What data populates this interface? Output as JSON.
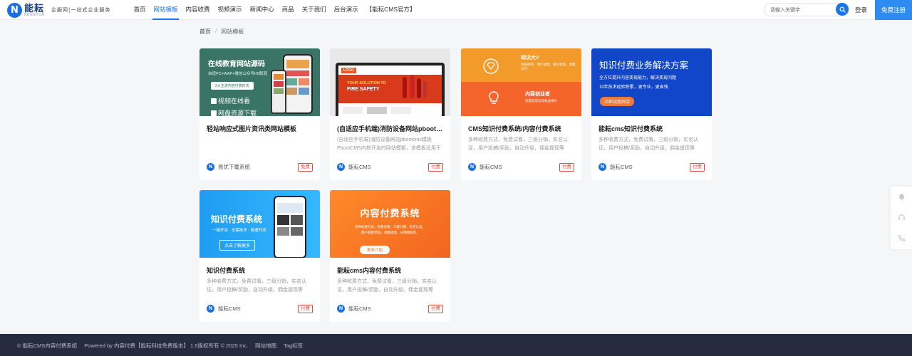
{
  "header": {
    "logo_mark": "N",
    "logo_name": "能耘",
    "logo_sub": "NENGYUN",
    "slogan": "企服网|一站式企业服务",
    "nav": [
      "首页",
      "网站模板",
      "内容收费",
      "视频演示",
      "新闻中心",
      "商品",
      "关于我们",
      "后台演示",
      "【能耘CMS官方】"
    ],
    "active_nav": 1,
    "search_placeholder": "请输入关键字",
    "login": "登录",
    "register": "免费注册"
  },
  "breadcrumb": {
    "home": "首页",
    "separator": "/",
    "current": "网站模板"
  },
  "cards": [
    {
      "title": "轻站响应式图片资讯类网站模板",
      "desc": "",
      "author": "易优下载系统",
      "badge": "免费",
      "image": {
        "headline": "在线教育网站源码",
        "sub": "自适PC+WAP+微信公众号H5联调",
        "tag": "2大主流内容付费形式",
        "line1": "视频在线看",
        "line2": "网盘资源下载"
      }
    },
    {
      "title": "(自适应手机端)消防设备网站pbootcms模板",
      "desc": "(自适应手机端)消防设备网站pbootcms模板 PbootCMS内核开发的网站模板，该模板适用于消防设备等企业",
      "author": "能耘CMS",
      "badge": "付费",
      "image": {
        "logo": "LOGO",
        "line1": "YOUR SOLUTION TO",
        "line2": "FIRE SAFETY"
      }
    },
    {
      "title": "CMS知识付费系统/内容付费系统",
      "desc": "多种收费方式，免费试看，三级分销，实名认证，用户投稿/奖励，自动升级，佣金提现等",
      "author": "能耘CMS",
      "badge": "付费",
      "image": {
        "top_title": "知识大V",
        "top_sub": "内容创作、用户运营、知识变现、流量合作",
        "bottom_title": "内容创业者",
        "bottom_sub": "流量变现实现收益增长"
      }
    },
    {
      "title": "能耘cms知识付费系统",
      "desc": "多种收费方式，免费试看，三级分销，实名认证，用户投稿/奖励，自动升级，佣金提现等",
      "author": "能耘CMS",
      "badge": "付费",
      "image": {
        "headline": "知识付费业务解决方案",
        "sub1": "全方位提升内容变现能力，解决变现问题",
        "sub2": "10年技术经验积累，更专业，更省钱",
        "button": "立即试用开店"
      }
    },
    {
      "title": "知识付费系统",
      "desc": "多种收费方式，免费试看，三级分销，实名认证，用户投稿/奖励，自动升级，佣金提现等",
      "author": "能耘CMS",
      "badge": "付费",
      "image": {
        "headline": "知识付费系统",
        "sub": "一键开店 · 无需技术 · 极速开店",
        "button": "点击了解更多"
      }
    },
    {
      "title": "能耘cms内容付费系统",
      "desc": "多种收费方式，免费试看，三级分销，实名认证，用户投稿/奖励，自动升级，佣金提现等",
      "author": "能耘CMS",
      "badge": "付费",
      "image": {
        "headline": "内容付费系统",
        "sub1": "多种收费方式，免费试看，三级分销，实名认证，",
        "sub2": "用户投稿/奖励，佣金提现，分销佣金等。",
        "button": "更多介绍"
      }
    }
  ],
  "footer": {
    "copyright": "© 能耘CMS内容付费系统",
    "powered": "Powered by 内容付费【能耘科技免费版本】 1.5版权所有 © 2025 Inc.",
    "links": [
      "网站地图",
      "Tag标签"
    ]
  },
  "colors": {
    "accent": "#1a73e8",
    "register": "#2d8cf0",
    "badge": "#e04a3a",
    "footer_bg": "#262b3f"
  }
}
